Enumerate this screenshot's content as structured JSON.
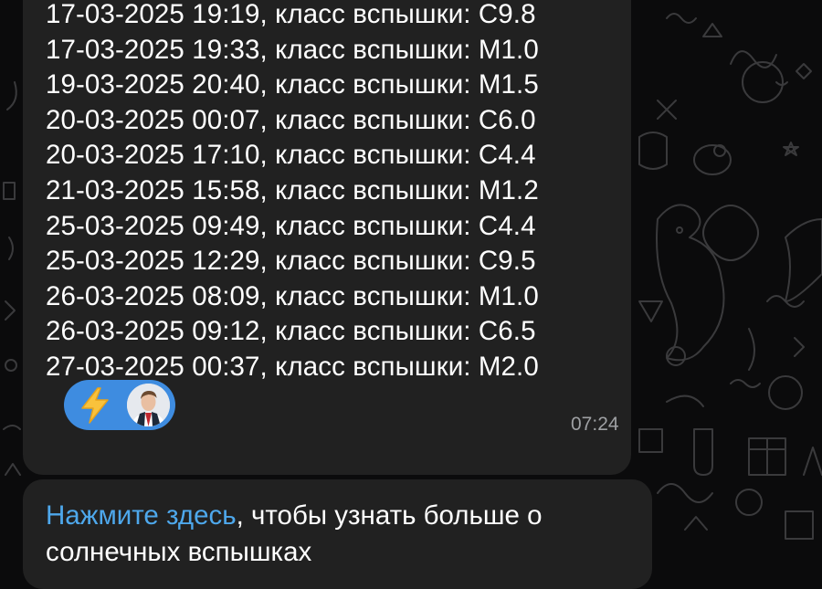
{
  "flare_list": [
    "17-03-2025 19:19, класс вспышки: C9.8",
    "17-03-2025 19:33, класс вспышки: M1.0",
    "19-03-2025 20:40, класс вспышки: M1.5",
    "20-03-2025 00:07, класс вспышки: C6.0",
    "20-03-2025 17:10, класс вспышки: C4.4",
    "21-03-2025 15:58, класс вспышки: M1.2",
    "25-03-2025 09:49, класс вспышки: C4.4",
    "25-03-2025 12:29, класс вспышки: C9.5",
    "26-03-2025 08:09, класс вспышки: M1.0",
    "26-03-2025 09:12, класс вспышки: C6.5",
    "27-03-2025 00:37, класс вспышки: M2.0"
  ],
  "reaction": {
    "emoji": "lightning-bolt-icon",
    "reactor": "avatar"
  },
  "message_time": "07:24",
  "next_message": {
    "link_text": "Нажмите здесь",
    "rest_text": ", чтобы узнать больше о солнечных вспышках"
  },
  "colors": {
    "background": "#0b0b0c",
    "bubble": "#212121",
    "text": "#ffffff",
    "link": "#4ea8ec",
    "reaction_pill": "#3e8ce0",
    "timestamp": "#9ea0a3"
  }
}
